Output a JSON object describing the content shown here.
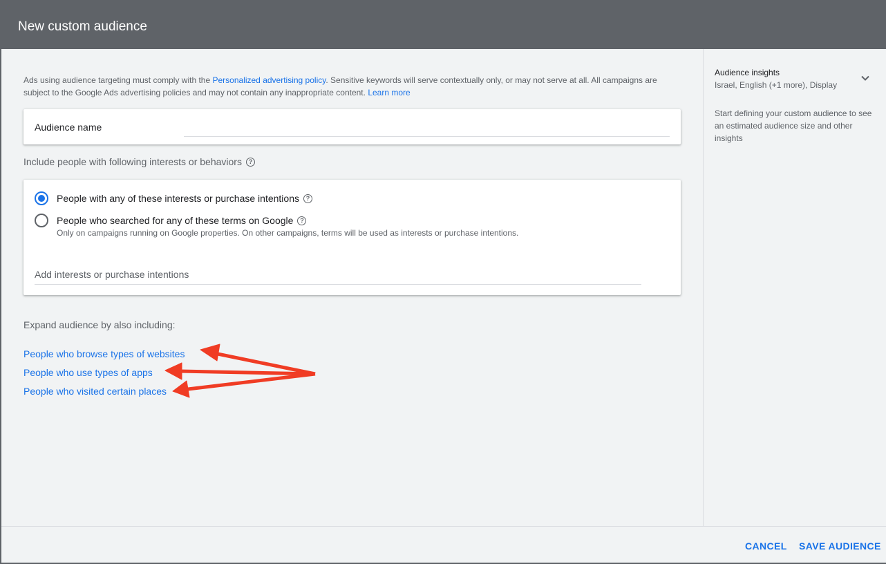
{
  "dialog": {
    "title": "New custom audience"
  },
  "policy": {
    "text_1": "Ads using audience targeting must comply with the ",
    "link_1": "Personalized advertising policy",
    "text_2": ". Sensitive keywords will serve contextually only, or may not serve at all. All campaigns are subject to the Google Ads advertising policies and may not contain any inappropriate content. ",
    "link_2": "Learn more"
  },
  "audience_name": {
    "label": "Audience name",
    "value": ""
  },
  "interests": {
    "section_label": "Include people with following interests or behaviors",
    "options": [
      {
        "label": "People with any of these interests or purchase intentions",
        "checked": true
      },
      {
        "label": "People who searched for any of these terms on Google",
        "checked": false,
        "sublabel": "Only on campaigns running on Google properties. On other campaigns, terms will be used as interests or purchase intentions."
      }
    ],
    "input_placeholder": "Add interests or purchase intentions"
  },
  "expand": {
    "label": "Expand audience by also including:",
    "links": [
      "People who browse types of websites",
      "People who use types of apps",
      "People who visited certain places"
    ]
  },
  "insights": {
    "title": "Audience insights",
    "subtitle": "Israel, English (+1 more), Display",
    "body": "Start defining your custom audience to see an estimated audience size and other insights"
  },
  "footer": {
    "cancel_label": "CANCEL",
    "save_label": "SAVE AUDIENCE"
  },
  "colors": {
    "accent": "#1a73e8",
    "header": "#5f6368",
    "annotation_arrow": "#f03c24"
  }
}
